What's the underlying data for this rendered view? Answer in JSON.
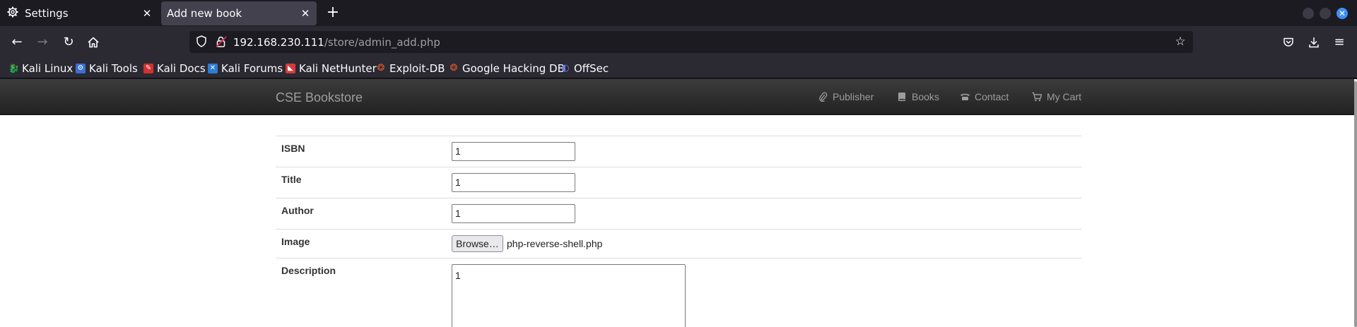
{
  "browser": {
    "tabs": [
      {
        "title": "Settings",
        "icon": "gear-icon"
      },
      {
        "title": "Add new book",
        "active": true
      }
    ],
    "url": {
      "host": "192.168.230.111",
      "path": "/store/admin_add.php"
    },
    "bookmarks": [
      {
        "label": "Kali Linux",
        "icon": "kali-dragon-icon",
        "color": "#1f1f1f"
      },
      {
        "label": "Kali Tools",
        "icon": "kali-tools-icon",
        "color": "#3b6fd1"
      },
      {
        "label": "Kali Docs",
        "icon": "kali-docs-icon",
        "color": "#d3302f"
      },
      {
        "label": "Kali Forums",
        "icon": "kali-forums-icon",
        "color": "#2d7dd2"
      },
      {
        "label": "Kali NetHunter",
        "icon": "nethunter-icon",
        "color": "#d83a3a"
      },
      {
        "label": "Exploit-DB",
        "icon": "exploit-db-icon",
        "color": "#e0582c"
      },
      {
        "label": "Google Hacking DB",
        "icon": "ghdb-icon",
        "color": "#e0582c"
      },
      {
        "label": "OffSec",
        "icon": "offsec-icon",
        "color": "#6c7ee1"
      }
    ]
  },
  "site": {
    "brand": "CSE Bookstore",
    "nav": [
      {
        "label": "Publisher",
        "icon": "paperclip-icon"
      },
      {
        "label": "Books",
        "icon": "book-icon"
      },
      {
        "label": "Contact",
        "icon": "phone-icon"
      },
      {
        "label": "My Cart",
        "icon": "cart-icon"
      }
    ]
  },
  "form": {
    "isbn": {
      "label": "ISBN",
      "value": "1"
    },
    "title": {
      "label": "Title",
      "value": "1"
    },
    "author": {
      "label": "Author",
      "value": "1"
    },
    "image": {
      "label": "Image",
      "button": "Browse…",
      "file": "php-reverse-shell.php"
    },
    "description": {
      "label": "Description",
      "value": "1"
    }
  }
}
